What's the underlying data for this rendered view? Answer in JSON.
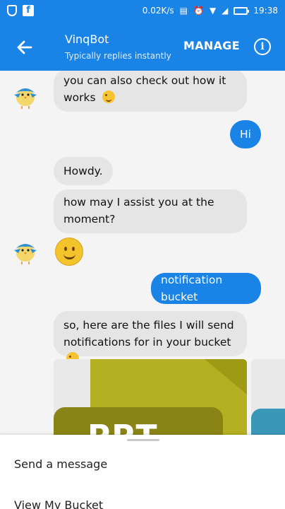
{
  "status_bar": {
    "net_speed": "0.02K/s",
    "time": "19:38",
    "icons": [
      "shield-icon",
      "facebook-icon",
      "sim-icon",
      "alarm-icon",
      "wifi-icon",
      "signal-icon",
      "battery-icon"
    ]
  },
  "header": {
    "bot_name": "VinqBot",
    "subtitle": "Typically replies instantly",
    "manage_label": "MANAGE",
    "info_symbol": "i"
  },
  "messages": [
    {
      "from": "bot",
      "text": "you can also check out how it works"
    },
    {
      "from": "user",
      "text": "Hi"
    },
    {
      "from": "bot",
      "text": "Howdy."
    },
    {
      "from": "bot",
      "text": "how may I assist you at the moment?"
    },
    {
      "from": "bot",
      "type": "emoji",
      "emoji": "smile"
    },
    {
      "from": "user",
      "text": "notification bucket"
    },
    {
      "from": "bot",
      "text": "so, here are the files I will send notifications for in your bucket"
    }
  ],
  "cards": {
    "card1_label": "PPT"
  },
  "bottom_sheet": {
    "options": [
      "Send a message",
      "View My Bucket"
    ]
  },
  "colors": {
    "primary": "#1a83e6",
    "bot_bubble": "#e5e5e5",
    "card_yellow": "#b5b021"
  }
}
